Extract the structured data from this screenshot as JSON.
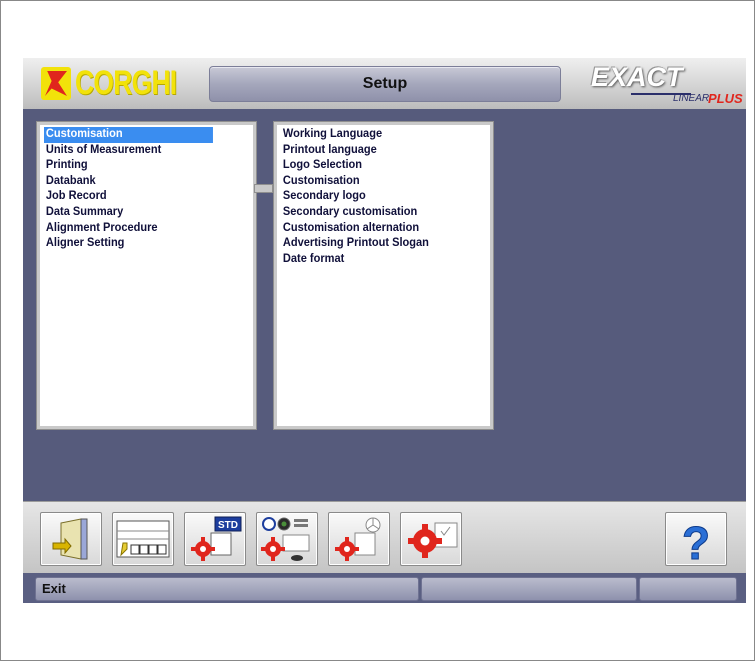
{
  "header": {
    "logo_text": "CORGHI",
    "title": "Setup",
    "brand_exact": "EXACT",
    "brand_linear": "LINEAR",
    "brand_plus": "PLUS"
  },
  "left_list": {
    "items": [
      "Customisation",
      "Units of Measurement",
      "Printing",
      "Databank",
      "Job Record",
      "Data Summary",
      "Alignment Procedure",
      "Aligner Setting"
    ],
    "selected_index": 0
  },
  "right_list": {
    "items": [
      "Working Language",
      "Printout language",
      "Logo Selection",
      "Customisation",
      "Secondary logo",
      "Secondary customisation",
      "Customisation alternation",
      "Advertising Printout Slogan",
      "Date format"
    ]
  },
  "toolbar": {
    "buttons": [
      {
        "icon": "exit-door-icon"
      },
      {
        "icon": "layout-grid-icon"
      },
      {
        "icon": "std-settings-icon",
        "label": "STD"
      },
      {
        "icon": "brand-settings-icon"
      },
      {
        "icon": "mercedes-settings-icon"
      },
      {
        "icon": "gear-settings-icon"
      },
      {
        "icon": "help-icon",
        "label": "?"
      }
    ]
  },
  "status": {
    "left_text": "Exit",
    "middle_text": "",
    "right_text": ""
  },
  "colors": {
    "background": "#565b7c",
    "selection": "#3a8df0",
    "logo_yellow": "#f2e20a",
    "brand_red": "#e0261d",
    "help_blue": "#2a6fd6"
  }
}
